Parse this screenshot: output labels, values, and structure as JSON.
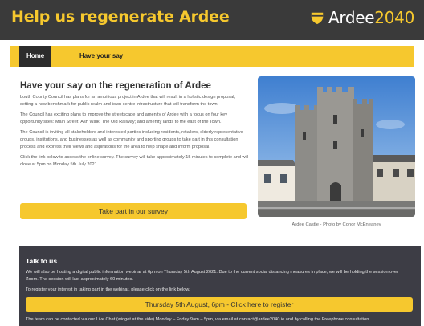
{
  "header": {
    "site_title": "Help us regenerate Ardee",
    "brand_text_main": "Ardee",
    "brand_text_year": "2040",
    "brand_icon": "shield-icon",
    "brand_color": "#f6c82e",
    "bar_color": "#3a3a3a"
  },
  "nav": {
    "items": [
      {
        "label": "Home",
        "active": true
      },
      {
        "label": "Have your say",
        "active": false
      }
    ]
  },
  "main": {
    "heading": "Have your say on the regeneration of Ardee",
    "paragraphs": [
      "Louth County Council has plans for an ambitious project in Ardee that will result in a holistic design proposal, setting a new benchmark for public realm and town centre infrastructure that will transform the town.",
      "The Council has exciting plans to improve the streetscape and amenity of Ardee with a focus on four key opportunity sites: Main Street, Ash Walk, The Old Railway; and amenity lands to the east of the Town.",
      "The Council is inviting all stakeholders and interested parties including residents, retailers, elderly representative groups, institutions, and businesses as well as community and sporting groups to take part in this consultation process and express their views and aspirations for the area to help shape and inform proposal.",
      "Click the link below to access the online survey. The survey will take approximately 15 minutes to complete and will close at 5pm on Monday 5th July 2021."
    ],
    "survey_button": "Take part in our survey",
    "photo_caption": "Ardee Castle - Photo by Conor McEneaney"
  },
  "talk": {
    "title": "Talk to us",
    "p1": "We will also be hosting a digital public information webinar at 6pm on Thursday 5th August 2021. Due to the current social distancing measures in place, we will be holding the session over Zoom. The session will last approximately 60 minutes.",
    "p2": "To register your interest in taking part in the webinar, please click on the link below.",
    "webinar_button": "Thursday 5th August, 6pm - Click here to register",
    "p3": "The team can be contacted via our Live Chat (widget at the side) Monday – Friday 9am – 5pm, via email at contact@ardee2040.ie and by calling the Freephone consultation"
  }
}
